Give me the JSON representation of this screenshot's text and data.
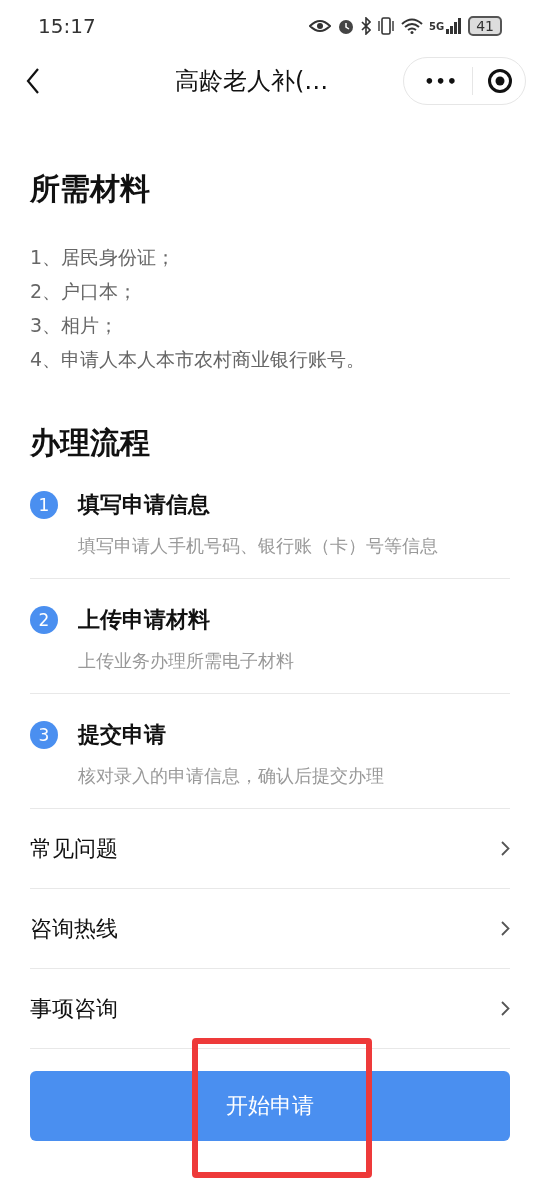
{
  "status_bar": {
    "time": "15:17",
    "network": "5G",
    "battery": "41"
  },
  "nav": {
    "title": "高龄老人补(…",
    "more": "•••"
  },
  "materials": {
    "title": "所需材料",
    "items": [
      "1、居民身份证；",
      "2、户口本；",
      "3、相片；",
      "4、申请人本人本市农村商业银行账号。"
    ]
  },
  "process": {
    "title": "办理流程",
    "steps": [
      {
        "number": "1",
        "title": "填写申请信息",
        "desc": "填写申请人手机号码、银行账（卡）号等信息"
      },
      {
        "number": "2",
        "title": "上传申请材料",
        "desc": "上传业务办理所需电子材料"
      },
      {
        "number": "3",
        "title": "提交申请",
        "desc": "核对录入的申请信息，确认后提交办理"
      }
    ]
  },
  "links": [
    {
      "label": "常见问题"
    },
    {
      "label": "咨询热线"
    },
    {
      "label": "事项咨询"
    }
  ],
  "button": {
    "label": "开始申请",
    "highlighted": true
  }
}
